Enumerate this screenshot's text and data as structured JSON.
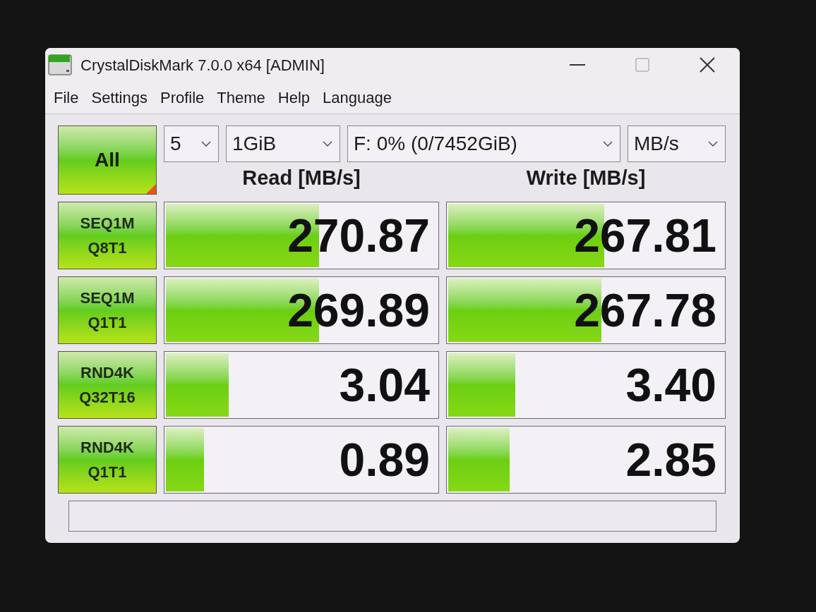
{
  "window": {
    "title": "CrystalDiskMark 7.0.0 x64 [ADMIN]",
    "maximize_disabled": true
  },
  "menu": [
    {
      "label": "File"
    },
    {
      "label": "Settings"
    },
    {
      "label": "Profile"
    },
    {
      "label": "Theme"
    },
    {
      "label": "Help"
    },
    {
      "label": "Language"
    }
  ],
  "all_button": {
    "label": "All"
  },
  "selectors": [
    {
      "value": "5"
    },
    {
      "value": "1GiB"
    },
    {
      "value": "F: 0% (0/7452GiB)"
    },
    {
      "value": "MB/s"
    }
  ],
  "columns": [
    {
      "label": "Read [MB/s]"
    },
    {
      "label": "Write [MB/s]"
    }
  ],
  "tests": [
    {
      "name": "SEQ1M",
      "params": "Q8T1",
      "read": {
        "value": "270.87",
        "level": 0.57
      },
      "write": {
        "value": "267.81",
        "level": 0.57
      }
    },
    {
      "name": "SEQ1M",
      "params": "Q1T1",
      "read": {
        "value": "269.89",
        "level": 0.57
      },
      "write": {
        "value": "267.78",
        "level": 0.56
      }
    },
    {
      "name": "RND4K",
      "params": "Q32T16",
      "read": {
        "value": "3.04",
        "level": 0.24
      },
      "write": {
        "value": "3.40",
        "level": 0.25
      }
    },
    {
      "name": "RND4K",
      "params": "Q1T1",
      "read": {
        "value": "0.89",
        "level": 0.15
      },
      "write": {
        "value": "2.85",
        "level": 0.23
      }
    }
  ]
}
